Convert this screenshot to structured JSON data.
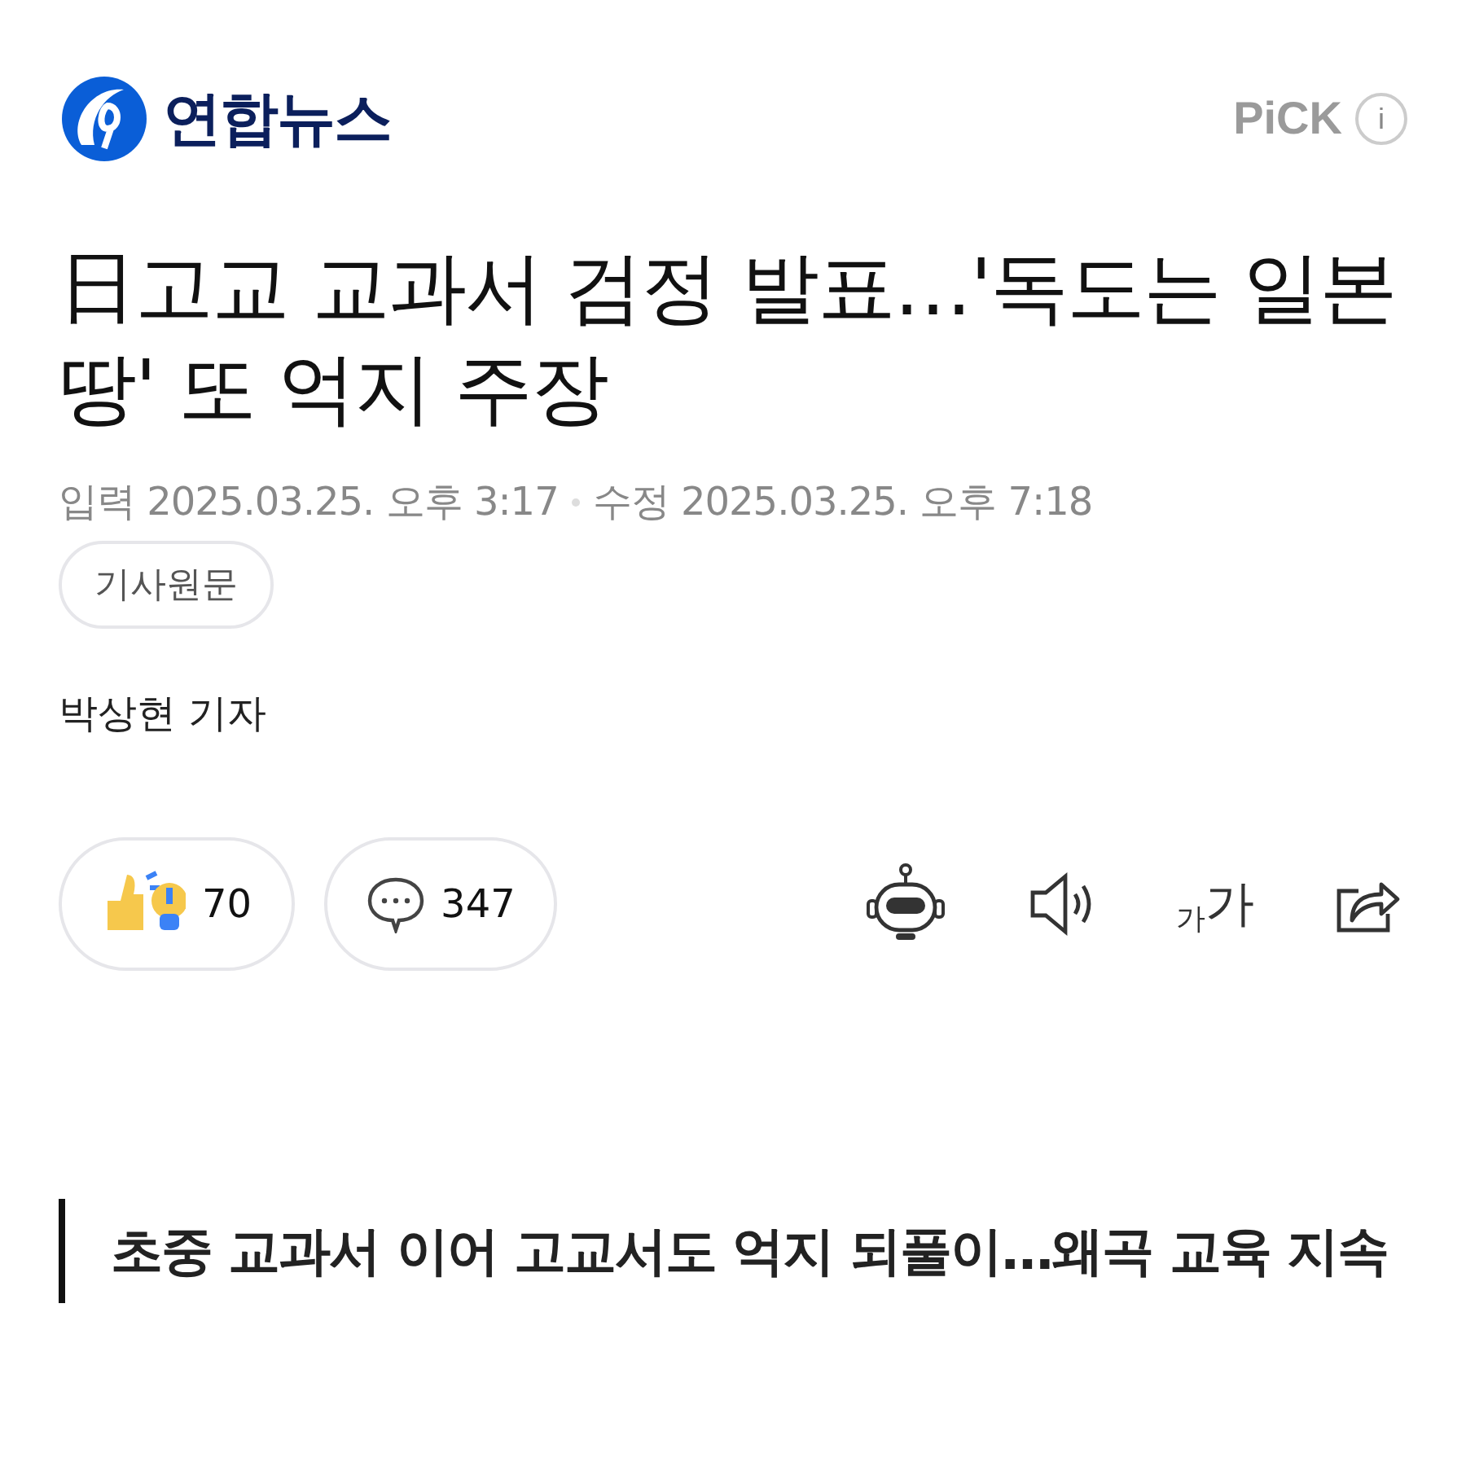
{
  "header": {
    "brand": "연합뉴스",
    "pick_label": "PiCK",
    "info_label": "i"
  },
  "headline": "日고교 교과서 검정 발표…'독도는 일본땅' 또 억지 주장",
  "meta": {
    "published_label": "입력",
    "published": "2025.03.25. 오후 3:17",
    "modified_label": "수정",
    "modified": "2025.03.25. 오후 7:18"
  },
  "original_button": "기사원문",
  "byline": "박상현 기자",
  "actions": {
    "reactions": "70",
    "comments": "347",
    "font_small": "가",
    "font_large": "가"
  },
  "subheading": "초중 교과서 이어 고교서도 억지 되풀이…왜곡 교육 지속"
}
